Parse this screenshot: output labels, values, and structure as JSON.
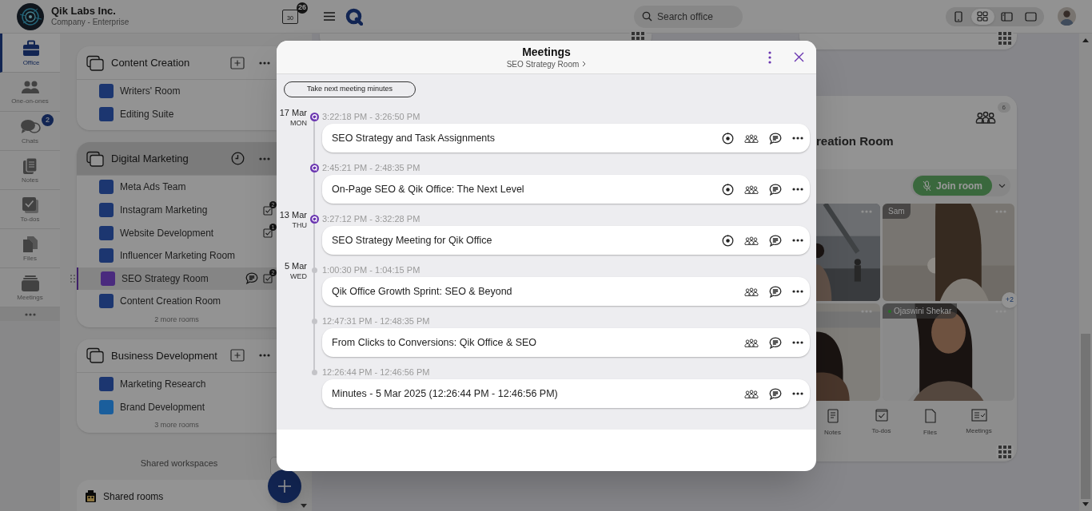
{
  "company": {
    "name": "Qik Labs Inc.",
    "subtitle": "Company - Enterprise"
  },
  "calendar": {
    "day": "30",
    "badge": "26"
  },
  "search": {
    "placeholder": "Search office"
  },
  "view_modes": [
    {
      "selected": false
    },
    {
      "selected": true
    },
    {
      "selected": false
    },
    {
      "selected": false
    }
  ],
  "nav": [
    {
      "label": "Office",
      "selected": true
    },
    {
      "label": "One-on-ones",
      "selected": false
    },
    {
      "label": "Chats",
      "selected": false,
      "badge": "2"
    },
    {
      "label": "Notes",
      "selected": false
    },
    {
      "label": "To-dos",
      "selected": false
    },
    {
      "label": "Files",
      "selected": false
    },
    {
      "label": "Meetings",
      "selected": false
    }
  ],
  "workspaces": [
    {
      "title": "Content Creation",
      "kind": "standard",
      "selected": false,
      "rooms": [
        {
          "name": "Writers' Room",
          "color": "#1c3670",
          "selected": false
        },
        {
          "name": "Editing Suite",
          "color": "#1c3670",
          "selected": false
        }
      ]
    },
    {
      "title": "Digital Marketing",
      "kind": "scheduled",
      "selected": true,
      "more": "2 more rooms",
      "rooms": [
        {
          "name": "Meta Ads Team",
          "color": "#1c3670",
          "selected": false
        },
        {
          "name": "Instagram Marketing",
          "color": "#1c3670",
          "selected": false,
          "todos": "2"
        },
        {
          "name": "Website Development",
          "color": "#1c3670",
          "selected": false,
          "todos": "1"
        },
        {
          "name": "Influencer Marketing Room",
          "color": "#1c3670",
          "selected": false
        },
        {
          "name": "SEO Strategy Room",
          "color": "#4a2a7e",
          "selected": true,
          "chat": true,
          "todos": "2"
        },
        {
          "name": "Content Creation Room",
          "color": "#1c3670",
          "selected": false
        }
      ]
    },
    {
      "title": "Business Development",
      "kind": "standard",
      "selected": false,
      "more": "3 more rooms",
      "rooms": [
        {
          "name": "Marketing Research",
          "color": "#1c3670",
          "selected": false
        },
        {
          "name": "Brand Development",
          "color": "#1a5e9c",
          "selected": false
        }
      ]
    }
  ],
  "shared_workspaces": "Shared workspaces",
  "shared_rooms": {
    "title": "Shared rooms"
  },
  "room_card": {
    "count": "6",
    "title": "reation Room",
    "join": "Join room",
    "tiles": [
      {
        "kind": "picture"
      },
      {
        "kind": "picture",
        "name": "Sam",
        "online": false
      },
      {
        "kind": "picture"
      },
      {
        "kind": "picture",
        "name": "Ojaswini Shekar",
        "online": true
      }
    ],
    "overflow": "+2",
    "tools": [
      "Notes",
      "To-dos",
      "Files",
      "Meetings"
    ]
  },
  "modal": {
    "title": "Meetings",
    "subtitle": "SEO Strategy Room",
    "minutes_button": "Take next meeting minutes",
    "meetings": [
      {
        "date": "17 Mar",
        "day": "MON",
        "time": "3:22:18 PM - 3:26:50 PM",
        "kind": "qik",
        "title": "SEO Strategy and Task Assignments",
        "recording": true
      },
      {
        "time": "2:45:21 PM - 2:48:35 PM",
        "kind": "qik",
        "title": "On-Page SEO & Qik Office: The Next Level",
        "recording": true
      },
      {
        "date": "13 Mar",
        "day": "THU",
        "time": "3:27:12 PM - 3:32:28 PM",
        "kind": "qik",
        "title": "SEO Strategy Meeting for Qik Office",
        "recording": true
      },
      {
        "date": "5 Mar",
        "day": "WED",
        "time": "1:00:30 PM - 1:04:15 PM",
        "kind": "dot",
        "title": "Qik Office Growth Sprint: SEO & Beyond",
        "recording": false
      },
      {
        "time": "12:47:31 PM - 12:48:35 PM",
        "kind": "dot",
        "title": "From Clicks to Conversions: Qik Office & SEO",
        "recording": false
      },
      {
        "time": "12:26:44 PM - 12:46:56 PM",
        "kind": "dot",
        "title": "Minutes - 5 Mar 2025 (12:26:44 PM - 12:46:56 PM)",
        "recording": false
      }
    ]
  }
}
